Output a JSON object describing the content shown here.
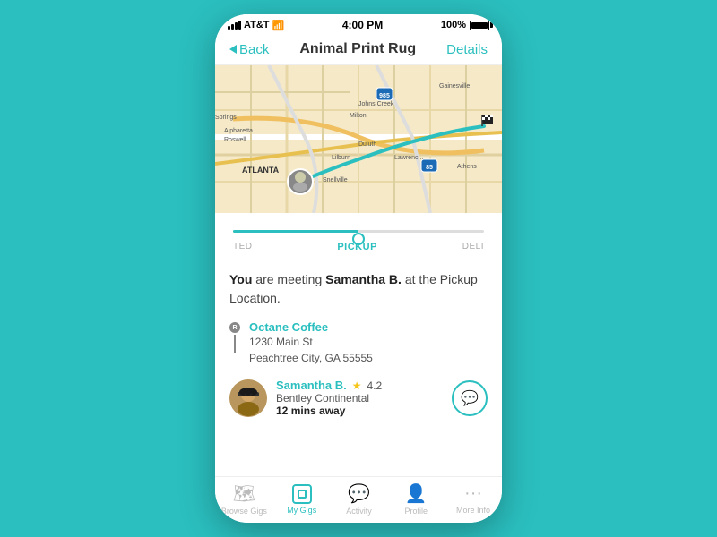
{
  "statusBar": {
    "carrier": "AT&T",
    "time": "4:00 PM",
    "battery": "100%"
  },
  "navBar": {
    "backLabel": "Back",
    "title": "Animal Print Rug",
    "detailsLabel": "Details"
  },
  "progress": {
    "steps": [
      "TED",
      "PICKUP",
      "DELI"
    ],
    "activeStep": "PICKUP",
    "activeIndex": 1
  },
  "meeting": {
    "text_before": "You",
    "text_mid": " are meeting ",
    "seller": "Samantha B.",
    "text_after": " at the Pickup Location."
  },
  "location": {
    "name": "Octane Coffee",
    "address_line1": "1230 Main St",
    "address_line2": "Peachtree City, GA 55555"
  },
  "sellerInfo": {
    "name": "Samantha B.",
    "rating": "4.2",
    "vehicle": "Bentley Continental",
    "distance": "12",
    "distanceUnit": "mins away"
  },
  "tabs": [
    {
      "id": "browse-gigs",
      "label": "Browse Gigs",
      "icon": "map",
      "active": false
    },
    {
      "id": "my-gigs",
      "label": "My Gigs",
      "icon": "box",
      "active": true
    },
    {
      "id": "activity",
      "label": "Activity",
      "icon": "chat",
      "active": false
    },
    {
      "id": "profile",
      "label": "Profile",
      "icon": "person",
      "active": false
    },
    {
      "id": "more-info",
      "label": "More Info",
      "icon": "more",
      "active": false
    }
  ]
}
